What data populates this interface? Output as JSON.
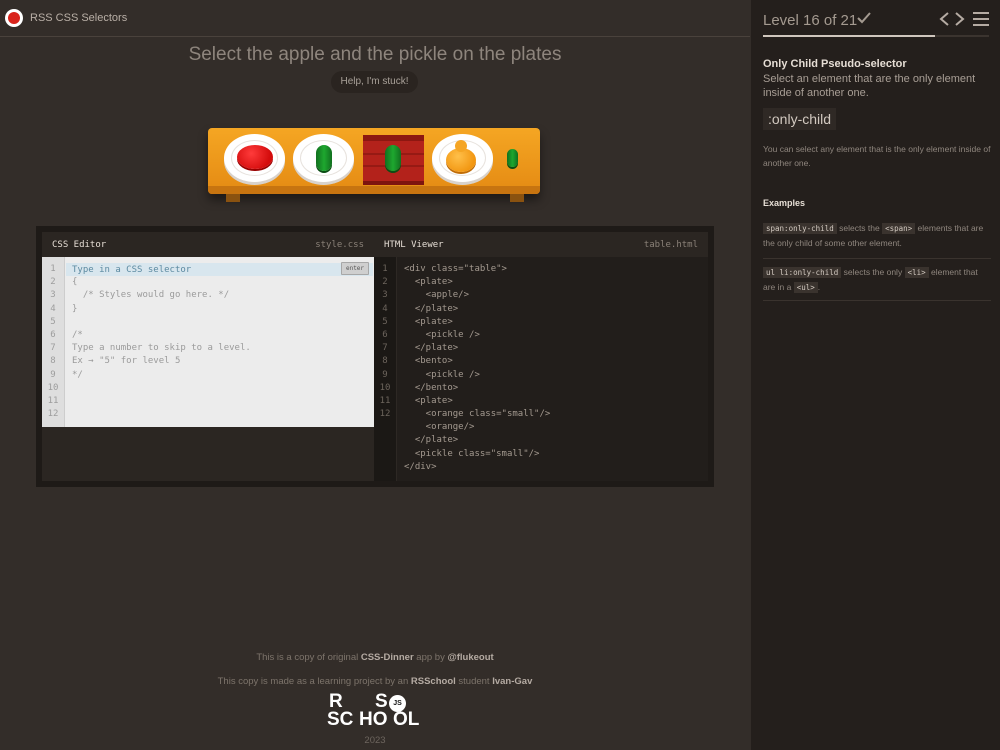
{
  "header": {
    "app_title": "RSS CSS Selectors"
  },
  "game": {
    "instruction": "Select the apple and the pickle on the plates",
    "help_button": "Help, I'm stuck!"
  },
  "css_editor": {
    "title": "CSS Editor",
    "filename": "style.css",
    "input_placeholder": "Type in a CSS selector",
    "enter_label": "enter",
    "line_numbers": [
      "1",
      "2",
      "3",
      "4",
      "5",
      "6",
      "7",
      "8",
      "9",
      "10",
      "11",
      "12"
    ],
    "lines": [
      "",
      "{",
      "  /* Styles would go here. */",
      "}",
      "",
      "/*",
      "Type a number to skip to a level.",
      "Ex → \"5\" for level 5",
      "*/",
      "",
      "",
      ""
    ]
  },
  "html_viewer": {
    "title": "HTML Viewer",
    "filename": "table.html",
    "line_numbers": [
      "1",
      "2",
      "3",
      "4",
      "5",
      "6",
      "7",
      "8",
      "9",
      "10",
      "11",
      "12",
      "",
      "",
      "",
      ""
    ],
    "lines": [
      "<div class=\"table\">",
      "  <plate>",
      "    <apple/>",
      "  </plate>",
      "  <plate>",
      "    <pickle />",
      "  </plate>",
      "  <bento>",
      "    <pickle />",
      "  </bento>",
      "  <plate>",
      "    <orange class=\"small\"/>",
      "    <orange/>",
      "  </plate>",
      "  <pickle class=\"small\"/>",
      "</div>"
    ]
  },
  "footer": {
    "line1_prefix": "This is a copy of original ",
    "line1_app": "CSS-Dinner",
    "line1_mid": " app by ",
    "line1_author": "@flukeout",
    "line2_prefix": "This copy is made as a learning project by an ",
    "line2_school": "RSSchool",
    "line2_mid": " student ",
    "line2_student": "Ivan-Gav",
    "logo_r": "R",
    "logo_s": "S",
    "logo_sc": "SC",
    "logo_ho": "HO",
    "logo_ol": "OL",
    "logo_js": "JS",
    "year": "2023"
  },
  "sidebar": {
    "level_text": "Level 16 of 21",
    "progress_fraction": 0.76,
    "selector_name": "Only Child Pseudo-selector",
    "selector_title": "Select an element that are the only element inside of another one.",
    "syntax": ":only-child",
    "hint": "You can select any element that is the only element inside of another one.",
    "examples_title": "Examples",
    "example1": {
      "code": "span:only-child",
      "t1": " selects the ",
      "tag": "<span>",
      "t2": " elements that are the only child of some other element."
    },
    "example2": {
      "code": "ul li:only-child",
      "t1": " selects the only ",
      "tag": "<li>",
      "t2": " element that are in a ",
      "tag2": "<ul>",
      "t3": "."
    }
  },
  "colors": {
    "accent_red": "#d9241c",
    "table_orange": "#f5a623",
    "background": "#332d29",
    "sidebar_bg": "#241f1c"
  }
}
